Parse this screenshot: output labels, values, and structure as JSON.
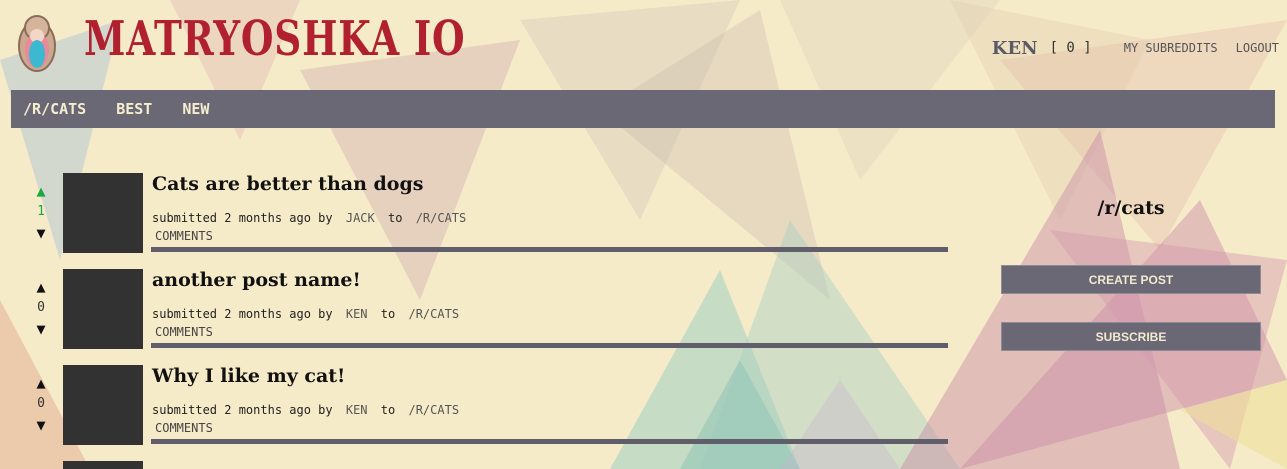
{
  "header": {
    "logo_text": "MATRYOSHKA IO",
    "user": "KEN",
    "karma": "[ 0 ]",
    "my_subreddits": "MY SUBREDDITS",
    "logout": "LOGOUT"
  },
  "tabs": [
    "/R/CATS",
    "BEST",
    "NEW"
  ],
  "posts": [
    {
      "score": "1",
      "title": "Cats are better than dogs",
      "submitted": "submitted 2 months ago by",
      "author": "JACK",
      "to": "to",
      "subreddit": "/R/CATS",
      "comments": "COMMENTS"
    },
    {
      "score": "0",
      "title": "another post name!",
      "submitted": "submitted 2 months ago by",
      "author": "KEN",
      "to": "to",
      "subreddit": "/R/CATS",
      "comments": "COMMENTS"
    },
    {
      "score": "0",
      "title": "Why I like my cat!",
      "submitted": "submitted 2 months ago by",
      "author": "KEN",
      "to": "to",
      "subreddit": "/R/CATS",
      "comments": "COMMENTS"
    }
  ],
  "sidebar": {
    "title": "/r/cats",
    "create_post": "CREATE POST",
    "subscribe": "SUBSCRIBE"
  },
  "colors": {
    "background": "#f6ebc9",
    "bar": "#696874",
    "upvote_active": "#19a940",
    "logo": "#b0202e"
  }
}
